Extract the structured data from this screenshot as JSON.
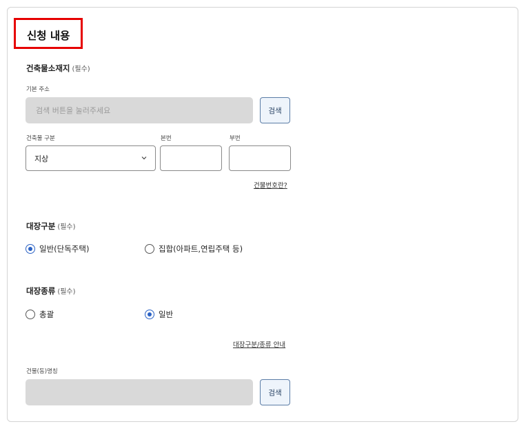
{
  "section_title": "신청 내용",
  "address": {
    "label": "건축물소재지",
    "required": "(필수)",
    "basic_label": "기본 주소",
    "basic_placeholder": "검색 버튼을 눌러주세요",
    "search_label": "검색"
  },
  "building": {
    "type_label": "건축물 구분",
    "type_selected": "지상",
    "main_no_label": "본번",
    "sub_no_label": "부번",
    "help_link": "건물번호란?"
  },
  "ledger_class": {
    "label": "대장구분",
    "required": "(필수)",
    "options": [
      "일반(단독주택)",
      "집합(아파트,연립주택 등)"
    ],
    "selected_index": 0
  },
  "ledger_kind": {
    "label": "대장종류",
    "required": "(필수)",
    "options": [
      "총괄",
      "일반"
    ],
    "selected_index": 1,
    "guide_link": "대장구분/종류 안내"
  },
  "building_name": {
    "label": "건물(동)명칭",
    "value": "",
    "search_label": "검색"
  },
  "colors": {
    "accent": "#2b62c4",
    "title_border": "#e60000",
    "disabled_fill": "#d9d9d9"
  }
}
